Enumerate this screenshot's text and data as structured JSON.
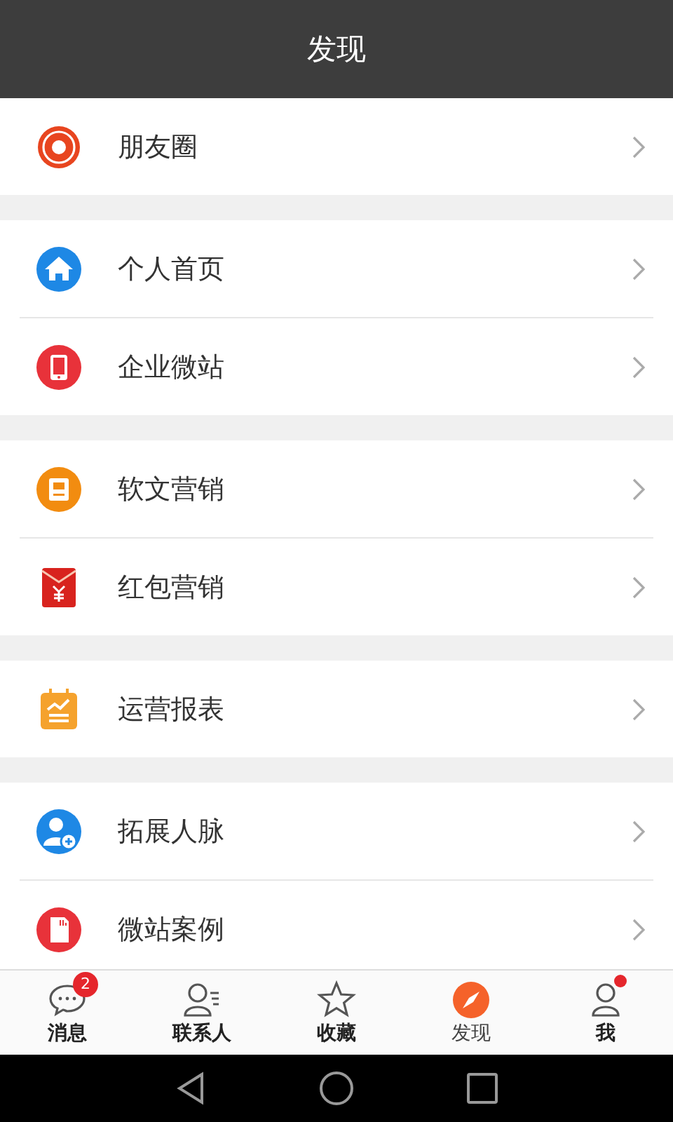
{
  "header": {
    "title": "发现"
  },
  "groups": [
    {
      "items": [
        {
          "label": "朋友圈",
          "kind": "logo"
        }
      ]
    },
    {
      "items": [
        {
          "label": "个人首页",
          "kind": "house"
        },
        {
          "label": "企业微站",
          "kind": "tablet"
        }
      ]
    },
    {
      "items": [
        {
          "label": "软文营销",
          "kind": "article"
        },
        {
          "label": "红包营销",
          "kind": "envelope"
        }
      ]
    },
    {
      "items": [
        {
          "label": "运营报表",
          "kind": "report"
        }
      ]
    },
    {
      "items": [
        {
          "label": "拓展人脉",
          "kind": "addperson"
        },
        {
          "label": "微站案例",
          "kind": "card"
        }
      ]
    }
  ],
  "tab_bar": [
    {
      "label": "消息",
      "kind": "chat",
      "selected": false,
      "badge": "2",
      "dot": false
    },
    {
      "label": "联系人",
      "kind": "contacts",
      "selected": false,
      "dot": false
    },
    {
      "label": "收藏",
      "kind": "star",
      "selected": false,
      "dot": false
    },
    {
      "label": "发现",
      "kind": "compass",
      "selected": true,
      "dot": false
    },
    {
      "label": "我",
      "kind": "person",
      "selected": false,
      "dot": true
    }
  ]
}
